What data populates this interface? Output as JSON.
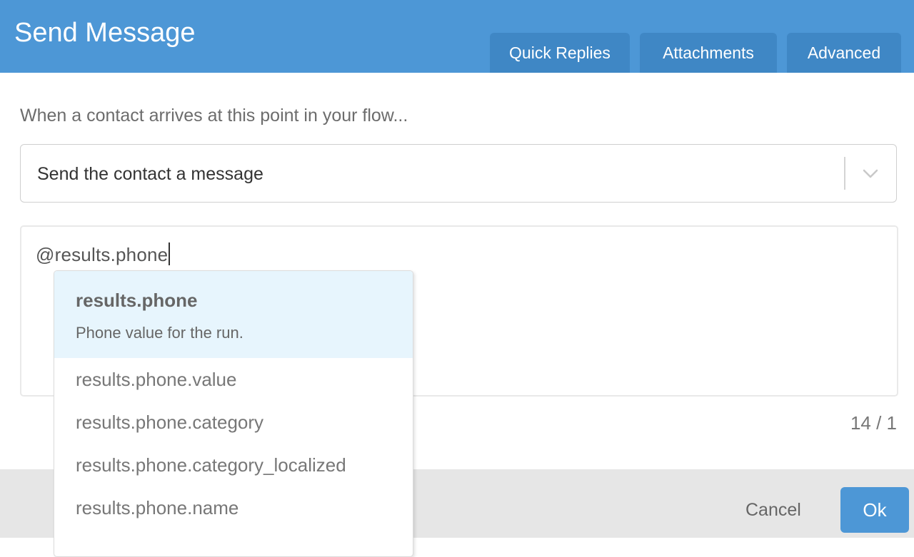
{
  "dialog": {
    "title": "Send Message",
    "tabs": [
      "Quick Replies",
      "Attachments",
      "Advanced"
    ]
  },
  "action": {
    "prompt": "When a contact arrives at this point in your flow...",
    "selected": "Send the contact a message"
  },
  "editor": {
    "value": "@results.phone",
    "counter": "14 / 1"
  },
  "autocomplete": {
    "selected": {
      "name": "results.phone",
      "description": "Phone value for the run."
    },
    "options": [
      "results.phone.value",
      "results.phone.category",
      "results.phone.category_localized",
      "results.phone.name"
    ]
  },
  "footer": {
    "cancel_label": "Cancel",
    "ok_label": "Ok"
  },
  "colors": {
    "header": "#4d97d6",
    "tab": "#3f87c5",
    "primary_button": "#4d97d6",
    "highlight": "#e7f5fd",
    "footer": "#e6e6e6"
  },
  "icons": {
    "select_arrow": "chevron-down-icon"
  }
}
